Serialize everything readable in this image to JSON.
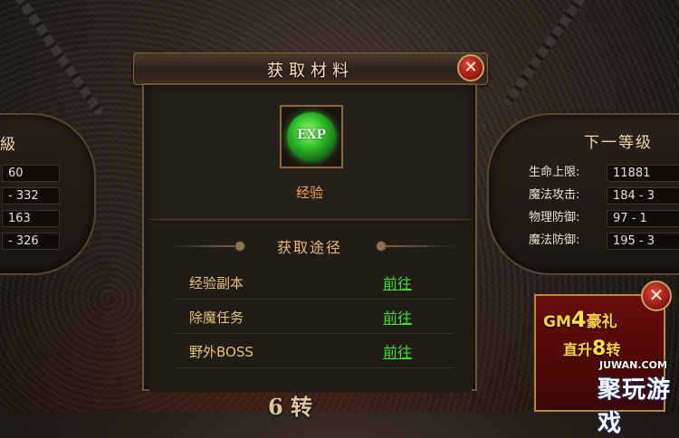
{
  "dialog": {
    "title": "获取材料",
    "close_icon": "close-icon",
    "item": {
      "icon_text": "EXP",
      "name": "经验"
    },
    "section_title": "获取途径",
    "routes": [
      {
        "name": "经验副本",
        "action": "前往"
      },
      {
        "name": "除魔任务",
        "action": "前往"
      },
      {
        "name": "野外BOSS",
        "action": "前往"
      }
    ]
  },
  "left_panel": {
    "title": "級",
    "values": [
      "60",
      "- 332",
      "163",
      "- 326"
    ]
  },
  "right_panel": {
    "title": "下一等级",
    "stats": [
      {
        "label": "生命上限:",
        "value": "11881"
      },
      {
        "label": "魔法攻击:",
        "value": "184 - 3"
      },
      {
        "label": "物理防御:",
        "value": "97 - 1"
      },
      {
        "label": "魔法防御:",
        "value": "195 - 3"
      }
    ]
  },
  "bottom": {
    "label": "6 转"
  },
  "promo": {
    "line1_prefix": "GM",
    "line1_num": "4",
    "line1_suffix": "豪礼",
    "line2_prefix": "直升",
    "line2_num": "8",
    "line2_suffix": "转"
  },
  "watermark": {
    "sub": "JUWAN.COM",
    "main": "聚玩游戏"
  },
  "colors": {
    "route_link": "#39e03a",
    "item_name": "#f2a050",
    "title_text": "#f0e0c0"
  }
}
